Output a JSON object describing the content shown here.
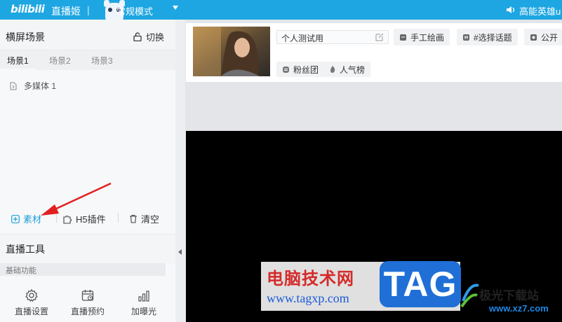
{
  "topbar": {
    "logo": "bilibili",
    "app_name": "直播姬",
    "separator": "|",
    "mode": "常规模式",
    "banner": "高能英雄u"
  },
  "scene_panel": {
    "title": "横屏场景",
    "switch_label": "切换",
    "tabs": [
      "场景1",
      "场景2",
      "场景3"
    ],
    "active_tab": 0,
    "sources": [
      {
        "label": "多媒体 1"
      }
    ]
  },
  "scene_actions": {
    "material": "素材",
    "h5_plugin": "H5插件",
    "clear": "清空"
  },
  "tools": {
    "title": "直播工具",
    "section": "基础功能",
    "items": [
      {
        "label": "直播设置",
        "icon": "gear-icon"
      },
      {
        "label": "直播预约",
        "icon": "calendar-icon"
      },
      {
        "label": "加曝光",
        "icon": "bar-chart-icon"
      }
    ]
  },
  "room": {
    "title_value": "个人测试用",
    "tags": [
      "手工绘画",
      "#选择话题",
      "公开"
    ],
    "fans_label": "粉丝团",
    "rank_label": "人气榜"
  },
  "watermark": {
    "site_cn": "电脑技术网",
    "site_url": "www.tagxp.com",
    "tag": "TAG",
    "brand2": "极光下载站",
    "brand2_url": "www.xz7.com"
  },
  "colors": {
    "topbar": "#1da6e2",
    "accent": "#1a9fd8",
    "arrow": "#e02020",
    "preview_bg": "#000000"
  }
}
